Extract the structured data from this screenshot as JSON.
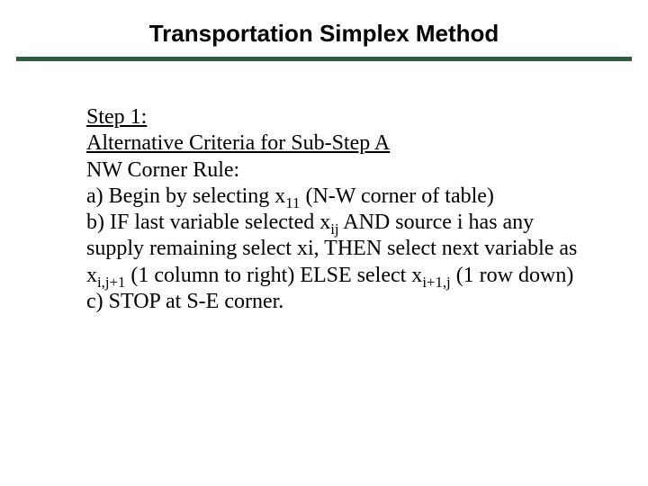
{
  "title": "Transportation Simplex Method",
  "step_label": "Step 1:",
  "alt_criteria": "Alternative Criteria for Sub-Step A",
  "nw_rule": "NW Corner Rule:",
  "a_prefix": "a) Begin by selecting x",
  "a_sub": "11",
  "a_suffix": " (N-W corner of table)",
  "b_prefix": "b) IF last variable selected x",
  "b_sub1": "ij",
  "b_mid1": " AND source i has any supply remaining select xi, THEN select next variable as x",
  "b_sub2": "i,j+1",
  "b_mid2": " (1 column to right) ELSE select x",
  "b_sub3": "i+1,j",
  "b_suffix": " (1 row down)",
  "c_text": "c) STOP at S-E corner."
}
